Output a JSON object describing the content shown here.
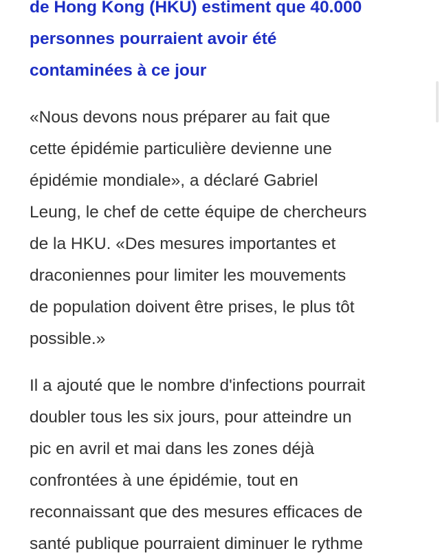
{
  "article": {
    "subheading_lines": [
      "de Hong Kong (HKU) estiment que 40.000",
      "personnes pourraient avoir été",
      "contaminées à ce jour"
    ],
    "paragraph1_lines": [
      "«Nous devons nous préparer au fait que",
      "cette épidémie particulière devienne une",
      "épidémie mondiale», a déclaré Gabriel",
      "Leung, le chef de cette équipe de chercheurs",
      "de la HKU. «Des mesures importantes et",
      "draconiennes pour limiter les mouvements",
      "de population doivent être prises, le plus tôt",
      "possible.»"
    ],
    "paragraph2_lines": [
      "Il a ajouté que le nombre d'infections pourrait",
      "doubler tous les six jours, pour atteindre un",
      "pic en avril et mai dans les zones déjà",
      "confrontées à une épidémie, tout en",
      "reconnaissant que des mesures efficaces de",
      "santé publique pourraient diminuer le rythme"
    ]
  },
  "colors": {
    "subheading": "#1e2fc4",
    "body_text": "#333333",
    "background": "#ffffff"
  }
}
